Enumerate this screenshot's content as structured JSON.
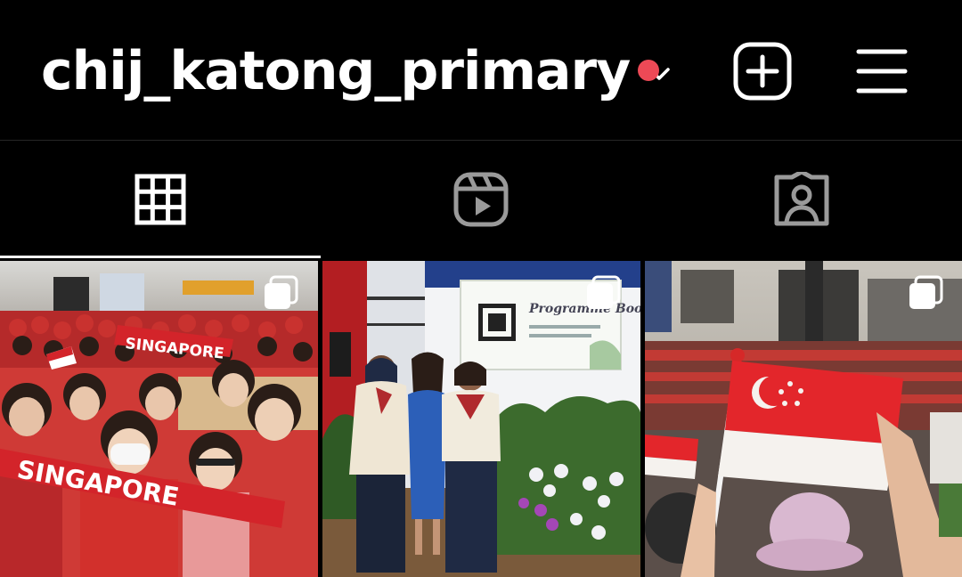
{
  "header": {
    "username": "chij_katong_primary",
    "username_chevron_icon": "chevron-down-icon",
    "notification_dot_color": "#ed4956",
    "new_post_icon": "plus-square-icon",
    "menu_icon": "hamburger-menu-icon"
  },
  "tabs": [
    {
      "name": "posts",
      "icon": "grid-icon",
      "active": true
    },
    {
      "name": "reels",
      "icon": "reels-icon",
      "active": false
    },
    {
      "name": "tagged",
      "icon": "tagged-person-icon",
      "active": false
    }
  ],
  "posts": [
    {
      "id": "post-1",
      "banner_top": "SINGAPORE",
      "banner_bottom": "SINGAPORE",
      "carousel_icon": "carousel-icon"
    },
    {
      "id": "post-2",
      "screen_title": "Programme Booklet",
      "carousel_icon": "carousel-icon"
    },
    {
      "id": "post-3",
      "carousel_icon": "carousel-icon"
    }
  ],
  "colors": {
    "background": "#000000",
    "text": "#ffffff",
    "divider": "#262626",
    "accent_red": "#ed4956"
  }
}
